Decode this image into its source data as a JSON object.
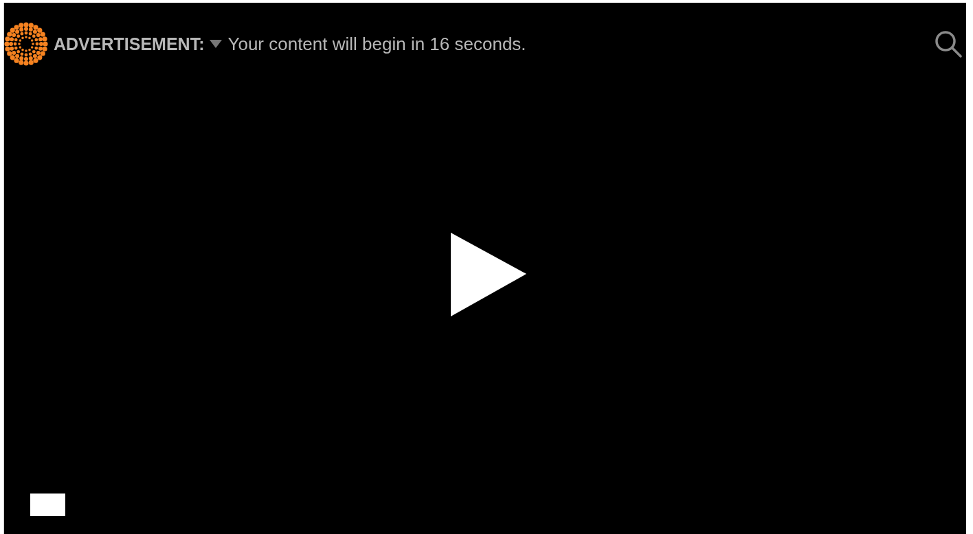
{
  "ad_notice": {
    "label": "ADVERTISEMENT:",
    "message": "Your content will begin in 16 seconds."
  }
}
